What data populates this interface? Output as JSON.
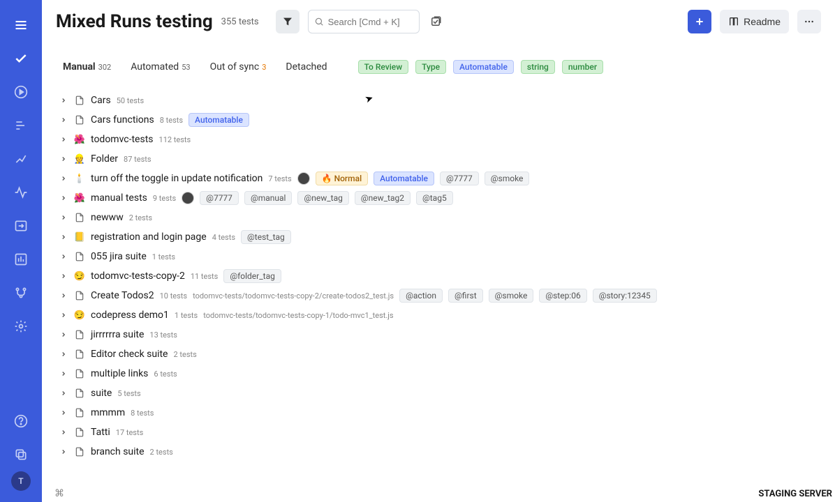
{
  "header": {
    "title": "Mixed Runs testing",
    "tests_count": "355 tests",
    "search_placeholder": "Search [Cmd + K]",
    "readme_label": "Readme"
  },
  "tabs": [
    {
      "label": "Manual",
      "count": "302",
      "active": true
    },
    {
      "label": "Automated",
      "count": "53"
    },
    {
      "label": "Out of sync",
      "count": "3",
      "warn": true
    },
    {
      "label": "Detached",
      "count": ""
    }
  ],
  "global_tags": [
    {
      "text": "To Review",
      "color": "green"
    },
    {
      "text": "Type",
      "color": "green"
    },
    {
      "text": "Automatable",
      "color": "blue"
    },
    {
      "text": "string",
      "color": "green"
    },
    {
      "text": "number",
      "color": "green"
    }
  ],
  "folders": [
    {
      "icon": "file",
      "name": "Cars",
      "tests": "50 tests",
      "tags": []
    },
    {
      "icon": "file",
      "name": "Cars functions",
      "tests": "8 tests",
      "tags": [
        {
          "text": "Automatable",
          "color": "blue"
        }
      ]
    },
    {
      "icon": "emoji",
      "emoji": "🌺",
      "name": "todomvc-tests",
      "tests": "112 tests",
      "tags": []
    },
    {
      "icon": "emoji",
      "emoji": "👷",
      "name": "Folder",
      "tests": "87 tests",
      "tags": []
    },
    {
      "icon": "emoji",
      "emoji": "🕯️",
      "name": "turn off the toggle in update notification",
      "tests": "7 tests",
      "avatar": true,
      "tags": [
        {
          "text": "🔥 Normal",
          "color": "yellow"
        },
        {
          "text": "Automatable",
          "color": "blue"
        },
        {
          "text": "@7777",
          "color": "gray"
        },
        {
          "text": "@smoke",
          "color": "gray"
        }
      ]
    },
    {
      "icon": "emoji",
      "emoji": "🌺",
      "name": "manual tests",
      "tests": "9 tests",
      "avatar": true,
      "tags": [
        {
          "text": "@7777",
          "color": "gray"
        },
        {
          "text": "@manual",
          "color": "gray"
        },
        {
          "text": "@new_tag",
          "color": "gray"
        },
        {
          "text": "@new_tag2",
          "color": "gray"
        },
        {
          "text": "@tag5",
          "color": "gray"
        }
      ]
    },
    {
      "icon": "file",
      "name": "newww",
      "tests": "2 tests",
      "tags": []
    },
    {
      "icon": "emoji",
      "emoji": "📒",
      "name": "registration and login page",
      "tests": "4 tests",
      "tags": [
        {
          "text": "@test_tag",
          "color": "gray"
        }
      ]
    },
    {
      "icon": "file",
      "name": "055 jira suite",
      "tests": "1 tests",
      "tags": []
    },
    {
      "icon": "emoji",
      "emoji": "😏",
      "name": "todomvc-tests-copy-2",
      "tests": "11 tests",
      "tags": [
        {
          "text": "@folder_tag",
          "color": "gray"
        }
      ]
    },
    {
      "icon": "file",
      "name": "Create Todos2",
      "tests": "10 tests",
      "path": "todomvc-tests/todomvc-tests-copy-2/create-todos2_test.js",
      "tags": [
        {
          "text": "@action",
          "color": "gray"
        },
        {
          "text": "@first",
          "color": "gray"
        },
        {
          "text": "@smoke",
          "color": "gray"
        },
        {
          "text": "@step:06",
          "color": "gray"
        },
        {
          "text": "@story:12345",
          "color": "gray"
        }
      ]
    },
    {
      "icon": "emoji",
      "emoji": "😏",
      "name": "codepress demo1",
      "tests": "1 tests",
      "path": "todomvc-tests/todomvc-tests-copy-1/todo-mvc1_test.js",
      "tags": []
    },
    {
      "icon": "file",
      "name": "jirrrrrra suite",
      "tests": "13 tests",
      "tags": []
    },
    {
      "icon": "file",
      "name": "Editor check suite",
      "tests": "2 tests",
      "tags": []
    },
    {
      "icon": "file",
      "name": "multiple links",
      "tests": "6 tests",
      "tags": []
    },
    {
      "icon": "file",
      "name": "suite",
      "tests": "5 tests",
      "tags": []
    },
    {
      "icon": "file",
      "name": "mmmm",
      "tests": "8 tests",
      "tags": []
    },
    {
      "icon": "file",
      "name": "Tatti",
      "tests": "17 tests",
      "tags": []
    },
    {
      "icon": "file",
      "name": "branch suite",
      "tests": "2 tests",
      "tags": []
    }
  ],
  "footer": {
    "staging": "STAGING SERVER",
    "avatar_letter": "T"
  }
}
